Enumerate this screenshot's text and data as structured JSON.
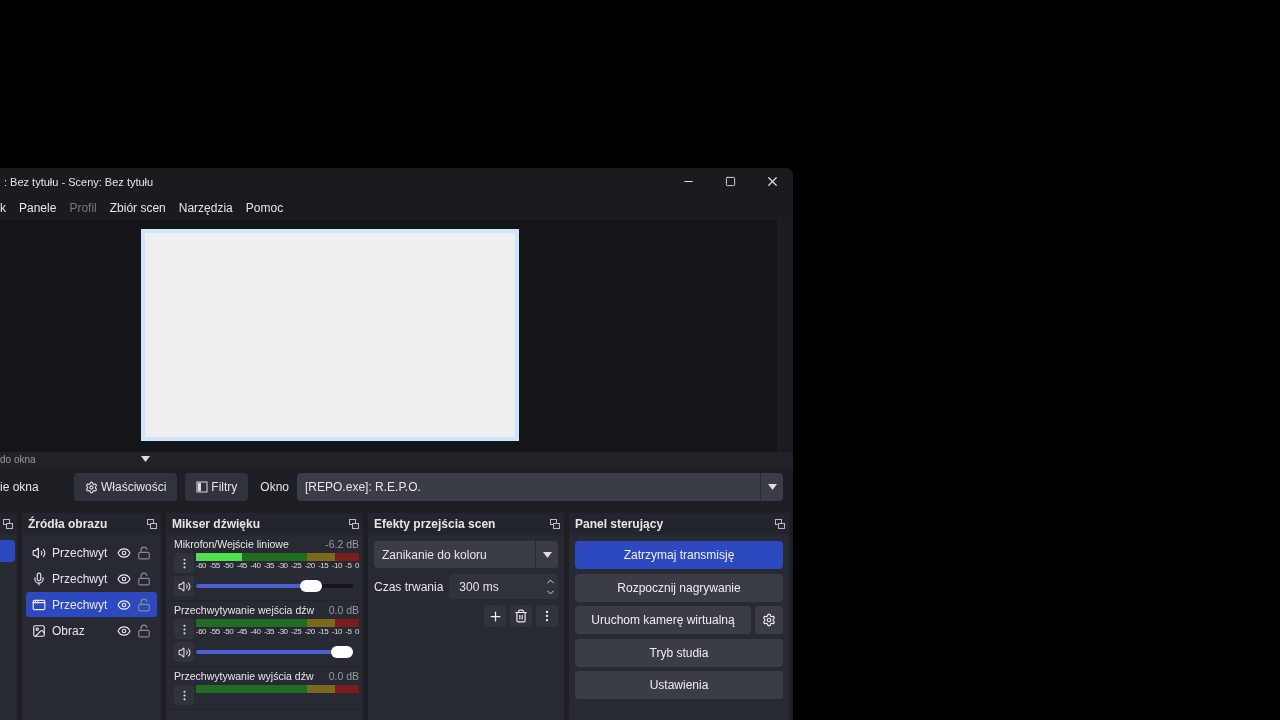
{
  "window": {
    "title": ": Bez tytułu - Sceny: Bez tytułu"
  },
  "menu": [
    {
      "label": "k",
      "disabled": false
    },
    {
      "label": "Panele",
      "disabled": false
    },
    {
      "label": "Profil",
      "disabled": true
    },
    {
      "label": "Zbiór scen",
      "disabled": false
    },
    {
      "label": "Narzędzia",
      "disabled": false
    },
    {
      "label": "Pomoc",
      "disabled": false
    }
  ],
  "source_bar": {
    "label": "do okna"
  },
  "properties_bar": {
    "source_name": "ie okna",
    "properties_button": "Właściwości",
    "filters_button": "Filtry",
    "window_label": "Okno",
    "window_value": "[REPO.exe]: R.E.P.O."
  },
  "scenes": {
    "items": [
      {
        "selected": true
      }
    ]
  },
  "sources": {
    "title": "Źródła obrazu",
    "items": [
      {
        "kind": "audio",
        "name": "Przechwyt",
        "visible": true,
        "locked": false,
        "selected": false
      },
      {
        "kind": "mic",
        "name": "Przechwyt",
        "visible": true,
        "locked": false,
        "selected": false
      },
      {
        "kind": "window",
        "name": "Przechwyt",
        "visible": true,
        "locked": false,
        "selected": true
      },
      {
        "kind": "image",
        "name": "Obraz",
        "visible": true,
        "locked": false,
        "selected": false
      }
    ]
  },
  "mixer": {
    "title": "Mikser dźwięku",
    "channels": [
      {
        "name": "Mikrofon/Wejście liniowe",
        "reading": "-6.2 dB",
        "meter": {
          "level": 0.28
        },
        "scale": [
          "-60",
          "-55",
          "-50",
          "-45",
          "-40",
          "-35",
          "-30",
          "-25",
          "-20",
          "-15",
          "-10",
          "-5",
          "0"
        ],
        "volume": {
          "level": 0.8
        }
      },
      {
        "name": "Przechwytywanie wejścia dźw",
        "reading": "0.0 dB",
        "meter": {
          "level": 0.0
        },
        "scale": [
          "-60",
          "-55",
          "-50",
          "-45",
          "-40",
          "-35",
          "-30",
          "-25",
          "-20",
          "-15",
          "-10",
          "-5",
          "0"
        ],
        "volume": {
          "level": 1.0
        }
      },
      {
        "name": "Przechwytywanie wyjścia dźw",
        "reading": "0.0 dB",
        "meter": {
          "level": 0.0
        }
      }
    ]
  },
  "transitions": {
    "title": "Efekty przejścia scen",
    "transition": "Zanikanie do koloru",
    "duration_label": "Czas trwania",
    "duration": "300 ms"
  },
  "controls": {
    "title": "Panel sterujący",
    "buttons": [
      {
        "label": "Zatrzymaj transmisję",
        "active": true,
        "kind": "plain"
      },
      {
        "label": "Rozpocznij nagrywanie",
        "active": false,
        "kind": "plain"
      },
      {
        "label": "Uruchom kamerę wirtualną",
        "active": false,
        "kind": "with-settings"
      },
      {
        "label": "Tryb studia",
        "active": false,
        "kind": "plain"
      },
      {
        "label": "Ustawienia",
        "active": false,
        "kind": "plain"
      }
    ]
  }
}
